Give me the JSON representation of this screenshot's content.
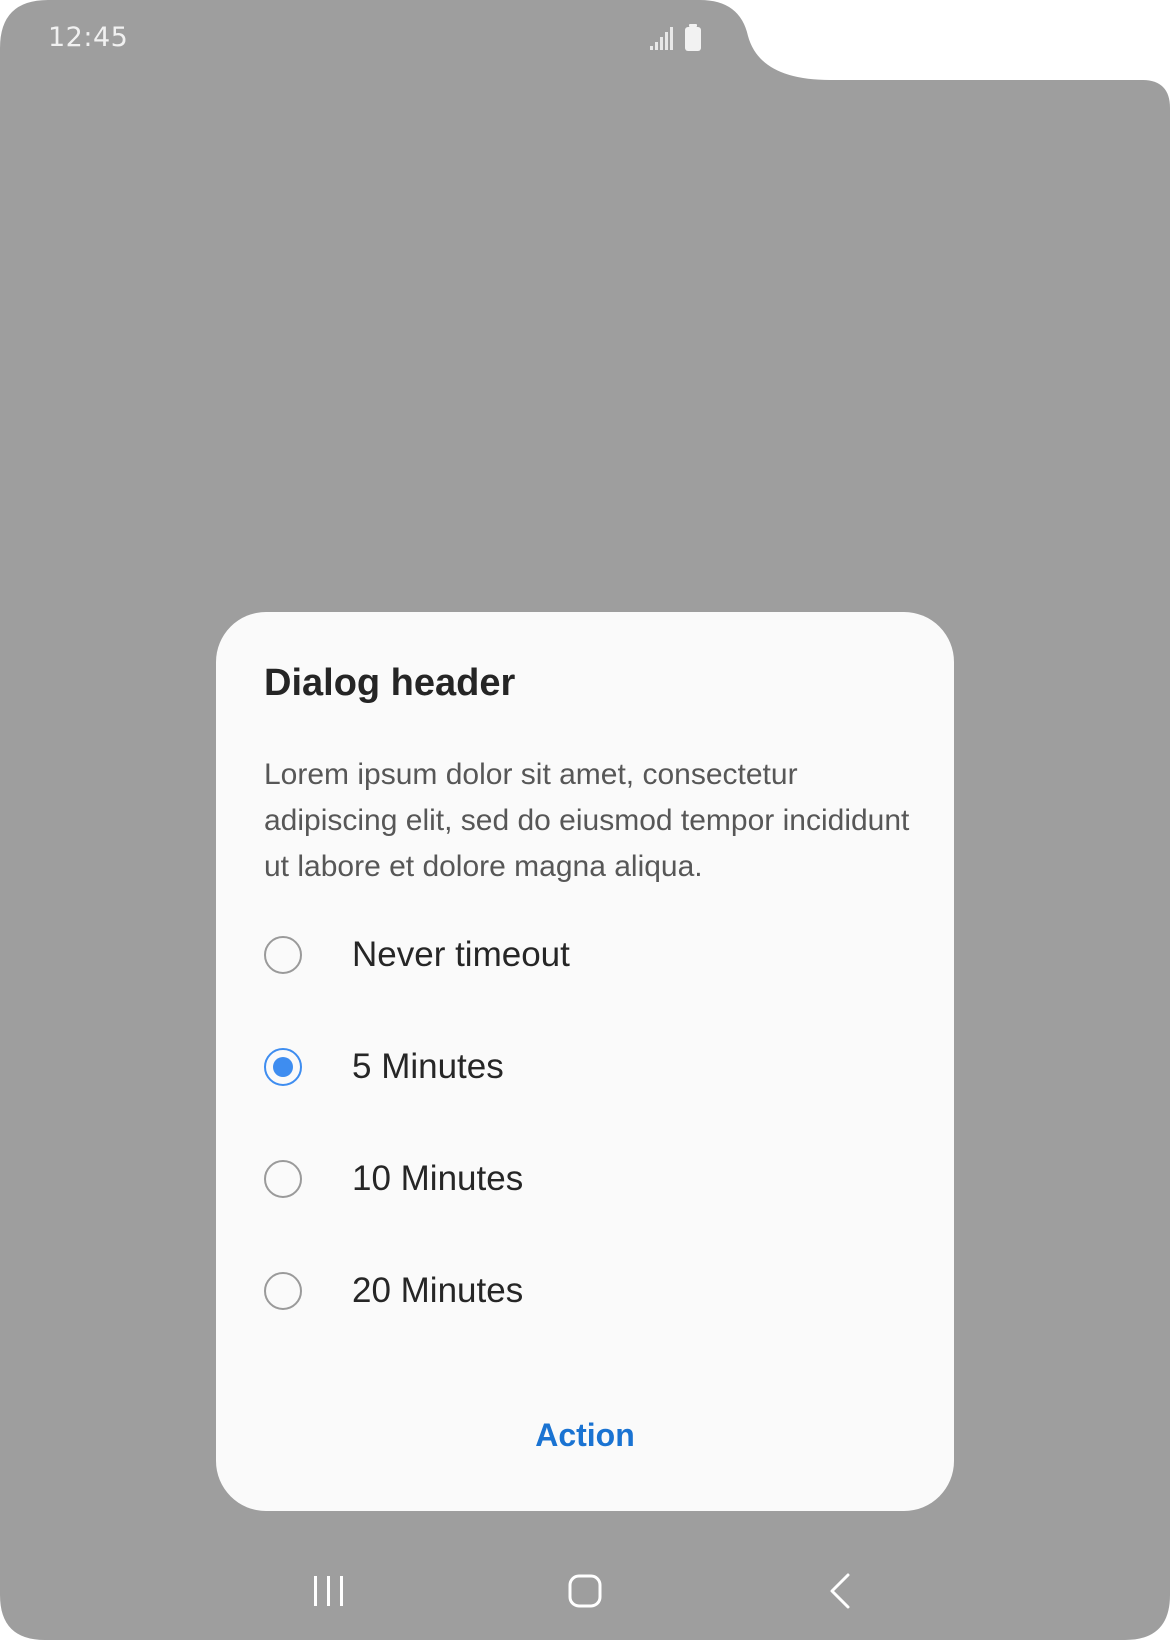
{
  "status_bar": {
    "time": "12:45",
    "icons": [
      "signal-icon",
      "battery-icon"
    ]
  },
  "dialog": {
    "title": "Dialog header",
    "body": "Lorem ipsum dolor sit amet, consectetur adipiscing elit, sed do eiusmod tempor incididunt ut labore et dolore magna aliqua.",
    "options": [
      {
        "label": "Never timeout",
        "selected": false
      },
      {
        "label": "5 Minutes",
        "selected": true
      },
      {
        "label": "10 Minutes",
        "selected": false
      },
      {
        "label": "20 Minutes",
        "selected": false
      }
    ],
    "action_label": "Action"
  },
  "nav_bar": {
    "buttons": [
      "recents-icon",
      "home-icon",
      "back-icon"
    ]
  },
  "colors": {
    "scrim": "#9e9e9e",
    "dialog_background": "#fafafa",
    "accent": "#3e8df0",
    "action_text": "#1a73d2"
  }
}
